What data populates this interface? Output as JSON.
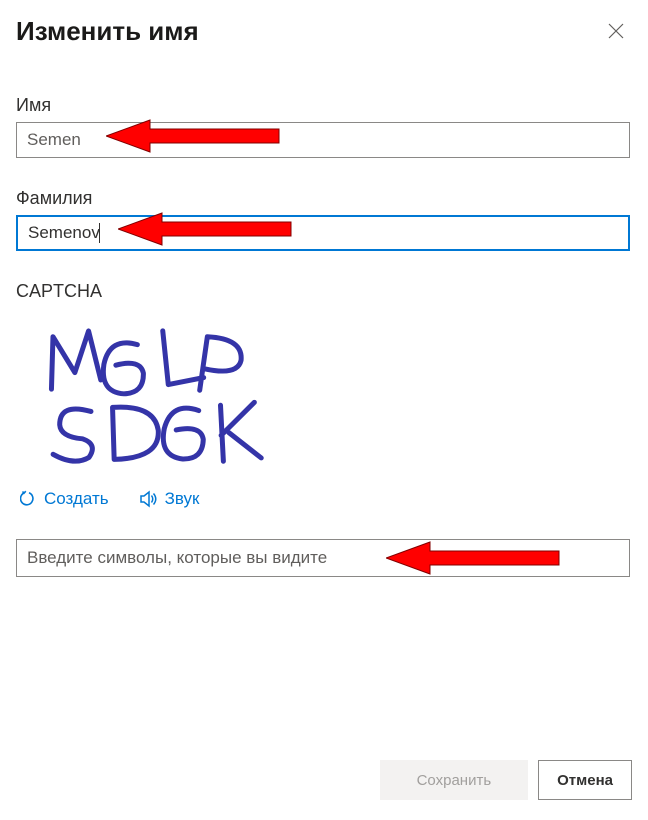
{
  "dialog": {
    "title": "Изменить имя"
  },
  "fields": {
    "first_name_label": "Имя",
    "first_name_value": "Semen",
    "last_name_label": "Фамилия",
    "last_name_value": "Semenov"
  },
  "captcha": {
    "label": "CAPTCHA",
    "text_top": "M6LP",
    "text_bottom": "SD6K",
    "regenerate_label": "Создать",
    "audio_label": "Звук",
    "input_placeholder": "Введите символы, которые вы видите"
  },
  "buttons": {
    "save": "Сохранить",
    "cancel": "Отмена"
  },
  "colors": {
    "accent": "#0078d4",
    "arrow": "#ff0000",
    "captcha_ink": "#3434a8"
  }
}
